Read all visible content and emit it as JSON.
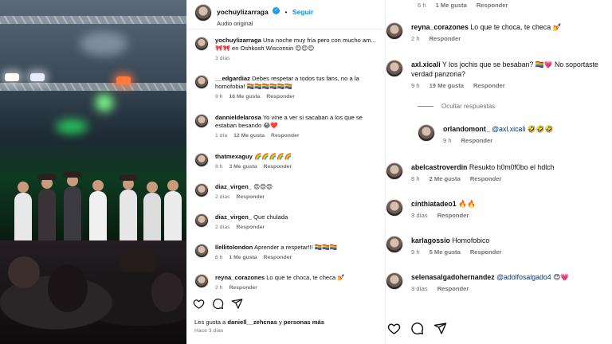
{
  "post": {
    "username": "yochuylizarraga",
    "follow_label": "Seguir",
    "audio": "Audio original",
    "caption": "Una noche muy fría pero con mucho am... 🎀🎀 en Oshkosh Wisconsin 😊😊😊",
    "time": "3 días",
    "likes_prefix": "Les gusta a ",
    "likes_user": "daniell__zehcnas",
    "likes_suffix": " y ",
    "likes_others": "personas más",
    "ago": "Hace 3 días"
  },
  "mid_comments": [
    {
      "user": "__edgardiaz",
      "text": "Debes respetar a todos tus fans, no a la homofobia! 🏳️‍🌈🏳️‍🌈🏳️‍🌈🏳️‍🌈🏳️‍🌈🏳️‍🌈",
      "time": "9 h",
      "likes": "16 Me gusta",
      "reply": "Responder"
    },
    {
      "user": "dannieldelarosa",
      "text": "Yo vine a ver si sacaban a los que se estaban besando 😂❤️",
      "time": "1 día",
      "likes": "12 Me gusta",
      "reply": "Responder"
    },
    {
      "user": "thatmexaguy",
      "text": "🌈🌈🌈🌈🌈",
      "time": "8 h",
      "likes": "3 Me gusta",
      "reply": "Responder"
    },
    {
      "user": "diaz_virgen_",
      "text": "😍😍😍",
      "time": "2 días",
      "likes": "",
      "reply": "Responder"
    },
    {
      "user": "diaz_virgen_",
      "text": "Que chulada",
      "time": "2 días",
      "likes": "",
      "reply": "Responder"
    },
    {
      "user": "llellitolondon",
      "text": "Aprender a respetar!!! 🏳️‍🌈🏳️‍🌈🏳️‍🌈",
      "time": "6 h",
      "likes": "1 Me gusta",
      "reply": "Responder"
    },
    {
      "user": "reyna_corazones",
      "text": "Lo que te choca, te checa 💅",
      "time": "2 h",
      "likes": "",
      "reply": "Responder"
    }
  ],
  "right_top": {
    "time": "6 h",
    "likes": "1 Me gusta",
    "reply": "Responder"
  },
  "right_comments": [
    {
      "user": "reyna_corazones",
      "text": "Lo que te choca, te checa 💅",
      "time": "2 h",
      "likes": "",
      "reply": "Responder"
    },
    {
      "user": "axl.xicali",
      "text": "Y los jochis que se besaban? 🏳️‍🌈💗 No soportaste verdad panzona?",
      "time": "9 h",
      "likes": "19 Me gusta",
      "reply": "Responder"
    }
  ],
  "hide_replies": "Ocultar respuestas",
  "reply_comment": {
    "user": "orlandomont_",
    "mention": "@axl.xicali",
    "text": "🤣🤣🤣",
    "time": "9 h",
    "reply": "Responder"
  },
  "right_comments_2": [
    {
      "user": "abelcastroverdin",
      "text": "Resukto h0m0f0bo el hdlch",
      "time": "8 h",
      "likes": "2 Me gusta",
      "reply": "Responder"
    },
    {
      "user": "cinthiatadeo1",
      "text": "🔥🔥",
      "time": "3 días",
      "likes": "",
      "reply": "Responder"
    },
    {
      "user": "karlagossio",
      "text": "Homofobico",
      "time": "9 h",
      "likes": "5 Me gusta",
      "reply": "Responder"
    },
    {
      "user": "selenasalgadohernandez",
      "mention": "@adolfosalgado4",
      "text": "😍💗",
      "time": "3 días",
      "likes": "",
      "reply": "Responder"
    }
  ],
  "icons": {
    "like": "heart-icon",
    "comment": "comment-icon",
    "share": "send-icon"
  },
  "colors": {
    "link": "#0095f6",
    "mention": "#00376b",
    "verified": "#1d9bf0",
    "meta": "#737373"
  }
}
